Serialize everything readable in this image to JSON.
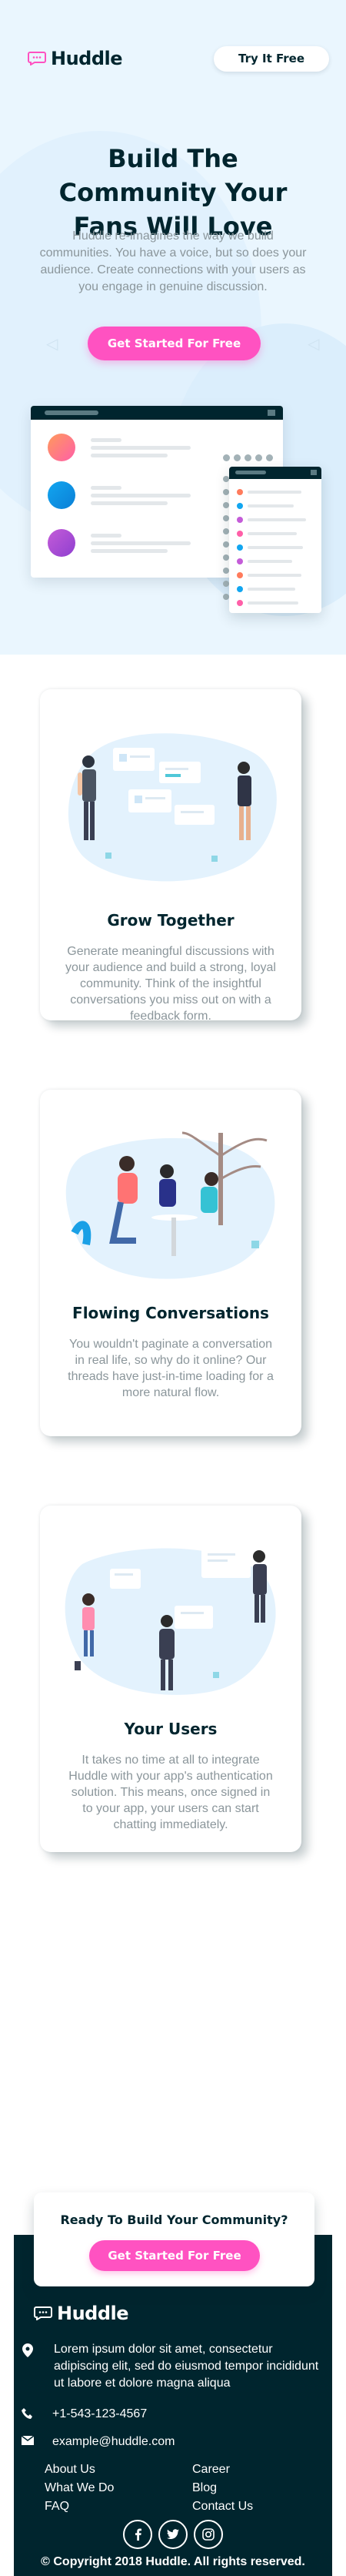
{
  "brand": {
    "name": "Huddle",
    "accent": "#ff52c1",
    "dark": "#00252e",
    "muted": "#8b969b",
    "hero_bg": "#eaf6fe"
  },
  "header": {
    "logo_icon": "chat-bubble-icon",
    "try_label": "Try It Free"
  },
  "hero": {
    "title": "Build The Community Your Fans Will Love",
    "text": "Huddle re-imagines the way we build communities. You have a voice, but so does your audience. Create connections with your users as you engage in genuine discussion.",
    "cta_label": "Get Started For Free"
  },
  "features": [
    {
      "title": "Grow Together",
      "text": "Generate meaningful discussions with your audience and build a strong, loyal community. Think of the insightful conversations you miss out on with a feedback form."
    },
    {
      "title": "Flowing Conversations",
      "text": "You wouldn't paginate a conversation in real life, so why do it online? Our threads have just-in-time loading for a more natural flow."
    },
    {
      "title": "Your Users",
      "text": "It takes no time at all to integrate Huddle with your app's authentication solution. This means, once signed in to your app, your users can start chatting immediately."
    }
  ],
  "cta": {
    "title": "Ready To Build Your Community?",
    "button_label": "Get Started For Free"
  },
  "footer": {
    "address": "Lorem ipsum dolor sit amet, consectetur adipiscing elit, sed do eiusmod tempor incididunt ut labore et dolore magna aliqua",
    "phone": "+1-543-123-4567",
    "email": "example@huddle.com",
    "links": [
      "About Us",
      "What We Do",
      "FAQ",
      "Career",
      "Blog",
      "Contact Us"
    ],
    "social_icons": [
      "facebook-icon",
      "twitter-icon",
      "instagram-icon"
    ],
    "copyright": "© Copyright 2018 Huddle. All rights reserved."
  }
}
